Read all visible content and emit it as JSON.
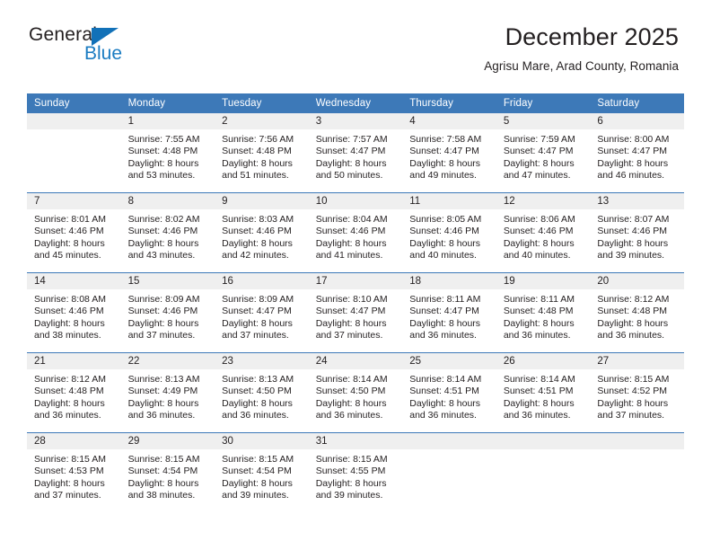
{
  "brand": {
    "name_top": "General",
    "name_bottom": "Blue",
    "triangle_color": "#1271b8",
    "blue_text_color": "#1b7cc2"
  },
  "header": {
    "title": "December 2025",
    "subtitle": "Agrisu Mare, Arad County, Romania"
  },
  "theme": {
    "header_blue": "#3d79b8",
    "daynum_band": "#efefef",
    "text": "#231f20"
  },
  "weekday_headers": [
    "Sunday",
    "Monday",
    "Tuesday",
    "Wednesday",
    "Thursday",
    "Friday",
    "Saturday"
  ],
  "weeks": [
    {
      "days": [
        {
          "num": "",
          "sunrise": "",
          "sunset": "",
          "daylight1": "",
          "daylight2": ""
        },
        {
          "num": "1",
          "sunrise": "Sunrise: 7:55 AM",
          "sunset": "Sunset: 4:48 PM",
          "daylight1": "Daylight: 8 hours",
          "daylight2": "and 53 minutes."
        },
        {
          "num": "2",
          "sunrise": "Sunrise: 7:56 AM",
          "sunset": "Sunset: 4:48 PM",
          "daylight1": "Daylight: 8 hours",
          "daylight2": "and 51 minutes."
        },
        {
          "num": "3",
          "sunrise": "Sunrise: 7:57 AM",
          "sunset": "Sunset: 4:47 PM",
          "daylight1": "Daylight: 8 hours",
          "daylight2": "and 50 minutes."
        },
        {
          "num": "4",
          "sunrise": "Sunrise: 7:58 AM",
          "sunset": "Sunset: 4:47 PM",
          "daylight1": "Daylight: 8 hours",
          "daylight2": "and 49 minutes."
        },
        {
          "num": "5",
          "sunrise": "Sunrise: 7:59 AM",
          "sunset": "Sunset: 4:47 PM",
          "daylight1": "Daylight: 8 hours",
          "daylight2": "and 47 minutes."
        },
        {
          "num": "6",
          "sunrise": "Sunrise: 8:00 AM",
          "sunset": "Sunset: 4:47 PM",
          "daylight1": "Daylight: 8 hours",
          "daylight2": "and 46 minutes."
        }
      ]
    },
    {
      "days": [
        {
          "num": "7",
          "sunrise": "Sunrise: 8:01 AM",
          "sunset": "Sunset: 4:46 PM",
          "daylight1": "Daylight: 8 hours",
          "daylight2": "and 45 minutes."
        },
        {
          "num": "8",
          "sunrise": "Sunrise: 8:02 AM",
          "sunset": "Sunset: 4:46 PM",
          "daylight1": "Daylight: 8 hours",
          "daylight2": "and 43 minutes."
        },
        {
          "num": "9",
          "sunrise": "Sunrise: 8:03 AM",
          "sunset": "Sunset: 4:46 PM",
          "daylight1": "Daylight: 8 hours",
          "daylight2": "and 42 minutes."
        },
        {
          "num": "10",
          "sunrise": "Sunrise: 8:04 AM",
          "sunset": "Sunset: 4:46 PM",
          "daylight1": "Daylight: 8 hours",
          "daylight2": "and 41 minutes."
        },
        {
          "num": "11",
          "sunrise": "Sunrise: 8:05 AM",
          "sunset": "Sunset: 4:46 PM",
          "daylight1": "Daylight: 8 hours",
          "daylight2": "and 40 minutes."
        },
        {
          "num": "12",
          "sunrise": "Sunrise: 8:06 AM",
          "sunset": "Sunset: 4:46 PM",
          "daylight1": "Daylight: 8 hours",
          "daylight2": "and 40 minutes."
        },
        {
          "num": "13",
          "sunrise": "Sunrise: 8:07 AM",
          "sunset": "Sunset: 4:46 PM",
          "daylight1": "Daylight: 8 hours",
          "daylight2": "and 39 minutes."
        }
      ]
    },
    {
      "days": [
        {
          "num": "14",
          "sunrise": "Sunrise: 8:08 AM",
          "sunset": "Sunset: 4:46 PM",
          "daylight1": "Daylight: 8 hours",
          "daylight2": "and 38 minutes."
        },
        {
          "num": "15",
          "sunrise": "Sunrise: 8:09 AM",
          "sunset": "Sunset: 4:46 PM",
          "daylight1": "Daylight: 8 hours",
          "daylight2": "and 37 minutes."
        },
        {
          "num": "16",
          "sunrise": "Sunrise: 8:09 AM",
          "sunset": "Sunset: 4:47 PM",
          "daylight1": "Daylight: 8 hours",
          "daylight2": "and 37 minutes."
        },
        {
          "num": "17",
          "sunrise": "Sunrise: 8:10 AM",
          "sunset": "Sunset: 4:47 PM",
          "daylight1": "Daylight: 8 hours",
          "daylight2": "and 37 minutes."
        },
        {
          "num": "18",
          "sunrise": "Sunrise: 8:11 AM",
          "sunset": "Sunset: 4:47 PM",
          "daylight1": "Daylight: 8 hours",
          "daylight2": "and 36 minutes."
        },
        {
          "num": "19",
          "sunrise": "Sunrise: 8:11 AM",
          "sunset": "Sunset: 4:48 PM",
          "daylight1": "Daylight: 8 hours",
          "daylight2": "and 36 minutes."
        },
        {
          "num": "20",
          "sunrise": "Sunrise: 8:12 AM",
          "sunset": "Sunset: 4:48 PM",
          "daylight1": "Daylight: 8 hours",
          "daylight2": "and 36 minutes."
        }
      ]
    },
    {
      "days": [
        {
          "num": "21",
          "sunrise": "Sunrise: 8:12 AM",
          "sunset": "Sunset: 4:48 PM",
          "daylight1": "Daylight: 8 hours",
          "daylight2": "and 36 minutes."
        },
        {
          "num": "22",
          "sunrise": "Sunrise: 8:13 AM",
          "sunset": "Sunset: 4:49 PM",
          "daylight1": "Daylight: 8 hours",
          "daylight2": "and 36 minutes."
        },
        {
          "num": "23",
          "sunrise": "Sunrise: 8:13 AM",
          "sunset": "Sunset: 4:50 PM",
          "daylight1": "Daylight: 8 hours",
          "daylight2": "and 36 minutes."
        },
        {
          "num": "24",
          "sunrise": "Sunrise: 8:14 AM",
          "sunset": "Sunset: 4:50 PM",
          "daylight1": "Daylight: 8 hours",
          "daylight2": "and 36 minutes."
        },
        {
          "num": "25",
          "sunrise": "Sunrise: 8:14 AM",
          "sunset": "Sunset: 4:51 PM",
          "daylight1": "Daylight: 8 hours",
          "daylight2": "and 36 minutes."
        },
        {
          "num": "26",
          "sunrise": "Sunrise: 8:14 AM",
          "sunset": "Sunset: 4:51 PM",
          "daylight1": "Daylight: 8 hours",
          "daylight2": "and 36 minutes."
        },
        {
          "num": "27",
          "sunrise": "Sunrise: 8:15 AM",
          "sunset": "Sunset: 4:52 PM",
          "daylight1": "Daylight: 8 hours",
          "daylight2": "and 37 minutes."
        }
      ]
    },
    {
      "days": [
        {
          "num": "28",
          "sunrise": "Sunrise: 8:15 AM",
          "sunset": "Sunset: 4:53 PM",
          "daylight1": "Daylight: 8 hours",
          "daylight2": "and 37 minutes."
        },
        {
          "num": "29",
          "sunrise": "Sunrise: 8:15 AM",
          "sunset": "Sunset: 4:54 PM",
          "daylight1": "Daylight: 8 hours",
          "daylight2": "and 38 minutes."
        },
        {
          "num": "30",
          "sunrise": "Sunrise: 8:15 AM",
          "sunset": "Sunset: 4:54 PM",
          "daylight1": "Daylight: 8 hours",
          "daylight2": "and 39 minutes."
        },
        {
          "num": "31",
          "sunrise": "Sunrise: 8:15 AM",
          "sunset": "Sunset: 4:55 PM",
          "daylight1": "Daylight: 8 hours",
          "daylight2": "and 39 minutes."
        },
        {
          "num": "",
          "sunrise": "",
          "sunset": "",
          "daylight1": "",
          "daylight2": ""
        },
        {
          "num": "",
          "sunrise": "",
          "sunset": "",
          "daylight1": "",
          "daylight2": ""
        },
        {
          "num": "",
          "sunrise": "",
          "sunset": "",
          "daylight1": "",
          "daylight2": ""
        }
      ]
    }
  ]
}
